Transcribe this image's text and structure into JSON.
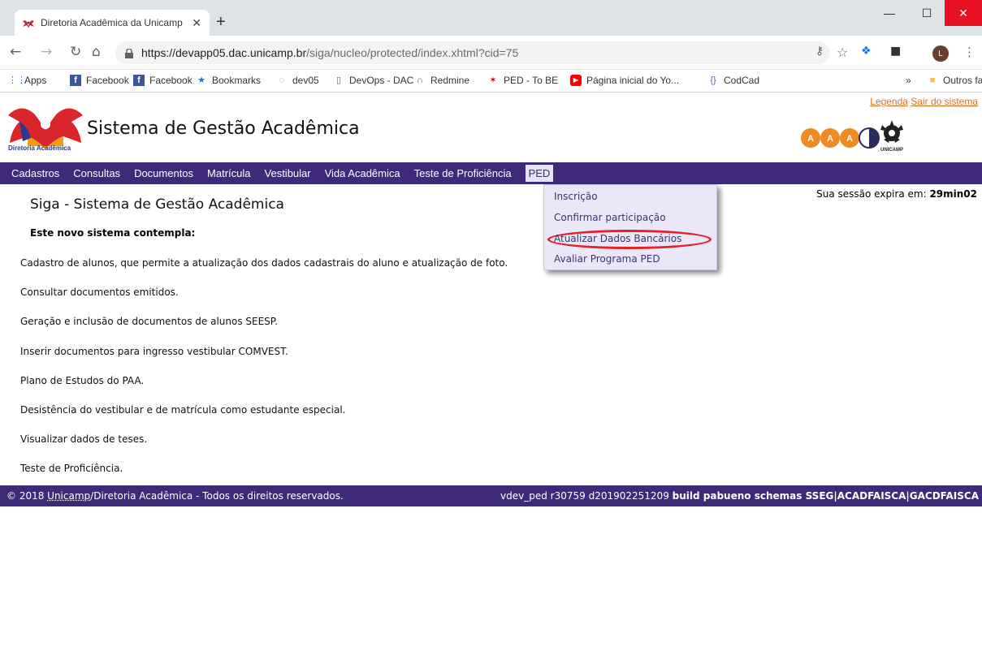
{
  "browser": {
    "tab_title": "Diretoria Acadêmica da Unicamp",
    "tab_close": "✕",
    "new_tab": "+",
    "url_host": "https://devapp05.dac.unicamp.br",
    "url_path": "/siga/nucleo/protected/index.xhtml?cid=75",
    "window": {
      "minimize": "—",
      "maximize": "☐",
      "close": "✕"
    },
    "profile_initial": "L"
  },
  "bookmarks": [
    {
      "label": "Apps",
      "icon": "apps-grid-icon",
      "color": "#1a73e8"
    },
    {
      "label": "Facebook",
      "icon": "facebook-icon",
      "color": "#3b5998"
    },
    {
      "label": "Facebook",
      "icon": "facebook-icon",
      "color": "#3b5998"
    },
    {
      "label": "Bookmarks",
      "icon": "star-icon",
      "color": "#1a73e8"
    },
    {
      "label": "dev05",
      "icon": "loading-icon",
      "color": "#34a853"
    },
    {
      "label": "DevOps - DAC",
      "icon": "page-icon",
      "color": "#5f6368"
    },
    {
      "label": "Redmine",
      "icon": "redmine-icon",
      "color": "#555555"
    },
    {
      "label": "PED - To BE",
      "icon": "unicamp-icon",
      "color": "#c00000"
    },
    {
      "label": "Página inicial do Yo...",
      "icon": "youtube-icon",
      "color": "#ff0000"
    },
    {
      "label": "CodCad",
      "icon": "codcad-icon",
      "color": "#7b4bb3"
    },
    {
      "label": "»",
      "icon": "",
      "color": ""
    },
    {
      "label": "Outros favoritos",
      "icon": "folder-icon",
      "color": "#f6c342"
    }
  ],
  "header": {
    "org": "Diretoria Acadêmica",
    "title": "Sistema de Gestão Acadêmica",
    "link_legenda": "Legenda",
    "link_sair": "Sair do sistema",
    "partner_logo_text": "UNICAMP",
    "aaa_letter": "A"
  },
  "menu": {
    "items": [
      "Cadastros",
      "Consultas",
      "Documentos",
      "Matrícula",
      "Vestibular",
      "Vida Acadêmica",
      "Teste de Proficiência"
    ],
    "active": "PED",
    "dropdown": [
      "Inscrição",
      "Confirmar participação",
      "Atualizar Dados Bancários",
      "Avaliar Programa PED"
    ]
  },
  "session": {
    "label": "Sua sessão expira em:",
    "time": "29min02"
  },
  "content": {
    "heading": "Siga - Sistema de Gestão Acadêmica",
    "intro": "Este novo sistema contempla:",
    "features": [
      "Cadastro de alunos, que permite a atualização dos dados cadastrais do aluno e atualização de foto.",
      "Consultar documentos emitidos.",
      "Geração e inclusão de documentos de alunos SEESP.",
      "Inserir documentos para ingresso vestibular COMVEST.",
      "Plano de Estudos do PAA.",
      "Desistência do vestibular e de matrícula como estudante especial.",
      "Visualizar dados de teses.",
      "Teste de Proficiência."
    ]
  },
  "footer": {
    "prefix": "© 2018 ",
    "link": "Unicamp",
    "suffix": "/Diretoria Acadêmica - Todos os direitos reservados.",
    "build": "vdev_ped r30759 d201902251209",
    "build_bold": "build pabueno schemas SSEG|ACADFAISCA|GACDFAISCA"
  },
  "colors": {
    "menu_bg": "#3e2a78",
    "dropdown_bg": "#eae8f8",
    "highlight_ring": "#e5202a",
    "header_link": "#e07020"
  }
}
